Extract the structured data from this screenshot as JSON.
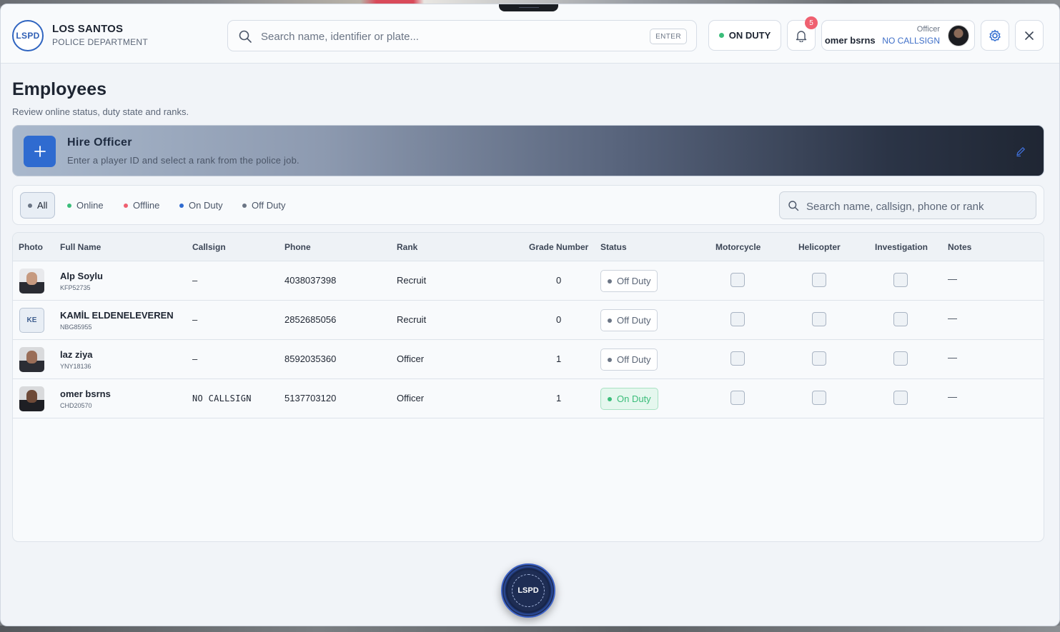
{
  "brand": {
    "logo_text": "LSPD",
    "title": "LOS SANTOS",
    "subtitle": "POLICE DEPARTMENT"
  },
  "global_search": {
    "placeholder": "Search name, identifier or plate...",
    "key_hint": "ENTER"
  },
  "duty": {
    "label": "ON DUTY",
    "dot_color": "#3bbd7a"
  },
  "notifications": {
    "count": "5"
  },
  "user": {
    "role": "Officer",
    "name": "omer bsrns",
    "callsign": "NO CALLSIGN"
  },
  "page": {
    "title": "Employees",
    "subtitle": "Review online status, duty state and ranks."
  },
  "hire": {
    "title": "Hire Officer",
    "subtitle": "Enter a player ID and select a rank from the police job."
  },
  "filters": [
    {
      "label": "All",
      "dot_color": "#6b7585",
      "active": true
    },
    {
      "label": "Online",
      "dot_color": "#3bbd7a",
      "active": false
    },
    {
      "label": "Offline",
      "dot_color": "#ef6070",
      "active": false
    },
    {
      "label": "On Duty",
      "dot_color": "#2f6bd0",
      "active": false
    },
    {
      "label": "Off Duty",
      "dot_color": "#6b7585",
      "active": false
    }
  ],
  "employee_search": {
    "placeholder": "Search name, callsign, phone or rank"
  },
  "table": {
    "columns": [
      "Photo",
      "Full Name",
      "Callsign",
      "Phone",
      "Rank",
      "Grade Number",
      "Status",
      "Motorcycle",
      "Helicopter",
      "Investigation",
      "Notes"
    ],
    "rows": [
      {
        "photo": "img",
        "initials": "",
        "name": "Alp Soylu",
        "identifier": "KFP52735",
        "callsign": "–",
        "phone": "4038037398",
        "rank": "Recruit",
        "grade": "0",
        "status": "Off Duty",
        "on_duty": false,
        "notes": "—"
      },
      {
        "photo": "initials",
        "initials": "KE",
        "name": "KAMİL ELDENELEVEREN",
        "identifier": "NBG85955",
        "callsign": "–",
        "phone": "2852685056",
        "rank": "Recruit",
        "grade": "0",
        "status": "Off Duty",
        "on_duty": false,
        "notes": "—"
      },
      {
        "photo": "img",
        "initials": "",
        "name": "laz ziya",
        "identifier": "YNY18136",
        "callsign": "–",
        "phone": "8592035360",
        "rank": "Officer",
        "grade": "1",
        "status": "Off Duty",
        "on_duty": false,
        "notes": "—"
      },
      {
        "photo": "img",
        "initials": "",
        "name": "omer bsrns",
        "identifier": "CHD20570",
        "callsign": "NO CALLSIGN",
        "phone": "5137703120",
        "rank": "Officer",
        "grade": "1",
        "status": "On Duty",
        "on_duty": true,
        "notes": "—"
      }
    ]
  },
  "emblem": {
    "text": "LSPD"
  },
  "colors": {
    "accent": "#2f6bd0",
    "on_duty": "#3bbd7a",
    "offline": "#ef6070",
    "neutral": "#6b7585"
  }
}
